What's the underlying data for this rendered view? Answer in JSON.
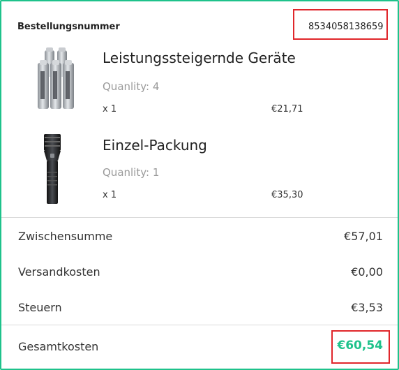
{
  "order": {
    "label": "Bestellungsnummer",
    "number": "8534058138659"
  },
  "items": [
    {
      "name": "Leistungssteigernde Geräte",
      "quantity_text": "Quanlity: 4",
      "multiplier": "x 1",
      "price": "€21,71",
      "icon": "battery-pack-image"
    },
    {
      "name": "Einzel-Packung",
      "quantity_text": "Quanlity: 1",
      "multiplier": "x 1",
      "price": "€35,30",
      "icon": "flashlight-image"
    }
  ],
  "summary": {
    "subtotal_label": "Zwischensumme",
    "subtotal_value": "€57,01",
    "shipping_label": "Versandkosten",
    "shipping_value": "€0,00",
    "tax_label": "Steuern",
    "tax_value": "€3,53",
    "total_label": "Gesamtkosten",
    "total_value": "€60,54"
  },
  "colors": {
    "accent": "#1ec28b",
    "highlight_border": "#e0262b"
  }
}
